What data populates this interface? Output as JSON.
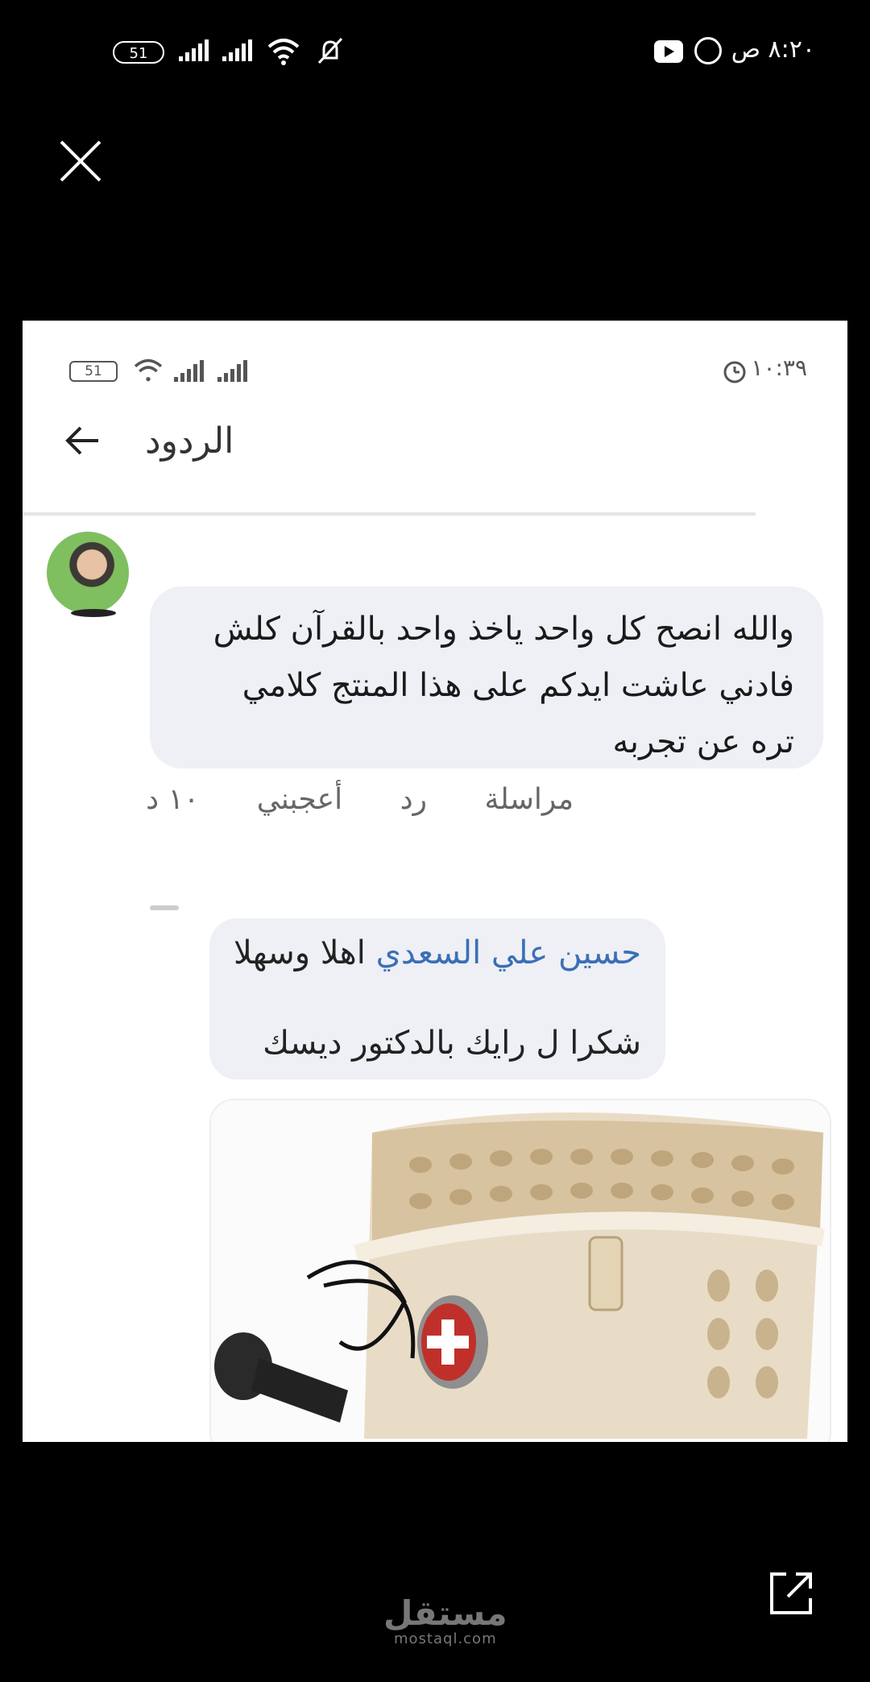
{
  "status_bar": {
    "battery": "51",
    "time": "٨:٢٠ ص"
  },
  "viewer": {
    "close_icon": "close-icon",
    "share_icon": "share-icon"
  },
  "inner_screenshot": {
    "status": {
      "battery": "51",
      "time": "١٠:٣٩"
    },
    "header": {
      "title": "الردود"
    },
    "comment": {
      "lines": [
        "والله انصح كل واحد ياخذ واحد بالقرآن كلش",
        "فادني عاشت ايدكم على هذا المنتج كلامي",
        "تره عن تجربه"
      ],
      "actions": {
        "message": "مراسلة",
        "reply": "رد",
        "like": "أعجبني",
        "time": "١٠ د"
      }
    },
    "reply": {
      "mention": "حسين علي السعدي",
      "greeting": " اهلا وسهلا",
      "line2": "شكرا ل رايك بالدكتور ديسك"
    }
  },
  "watermark": {
    "arabic": "مستقل",
    "latin": "mostaql.com"
  }
}
